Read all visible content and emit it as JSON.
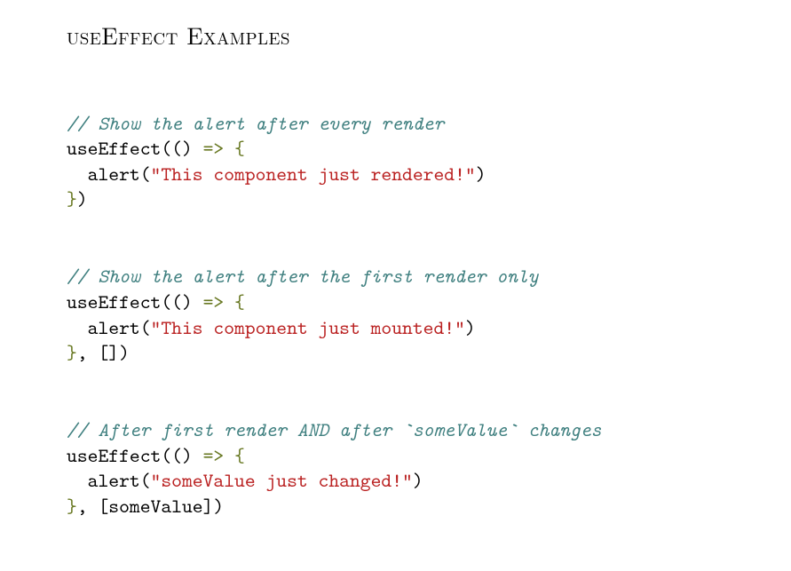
{
  "heading": "useEffect Examples",
  "block1": {
    "comment": "// Show the alert after every render",
    "line1_a": "useEffect(() ",
    "line1_arrow": "=> ",
    "line1_brace": "{",
    "line2_a": "  alert(",
    "line2_str": "\"This component just rendered!\"",
    "line2_b": ")",
    "line3_brace": "}",
    "line3_b": ")"
  },
  "block2": {
    "comment": "// Show the alert after the first render only",
    "line1_a": "useEffect(() ",
    "line1_arrow": "=> ",
    "line1_brace": "{",
    "line2_a": "  alert(",
    "line2_str": "\"This component just mounted!\"",
    "line2_b": ")",
    "line3_brace": "}",
    "line3_b": ", [])"
  },
  "block3": {
    "comment": "// After first render AND after `someValue` changes",
    "line1_a": "useEffect(() ",
    "line1_arrow": "=> ",
    "line1_brace": "{",
    "line2_a": "  alert(",
    "line2_str": "\"someValue just changed!\"",
    "line2_b": ")",
    "line3_brace": "}",
    "line3_b": ", [someValue])"
  }
}
